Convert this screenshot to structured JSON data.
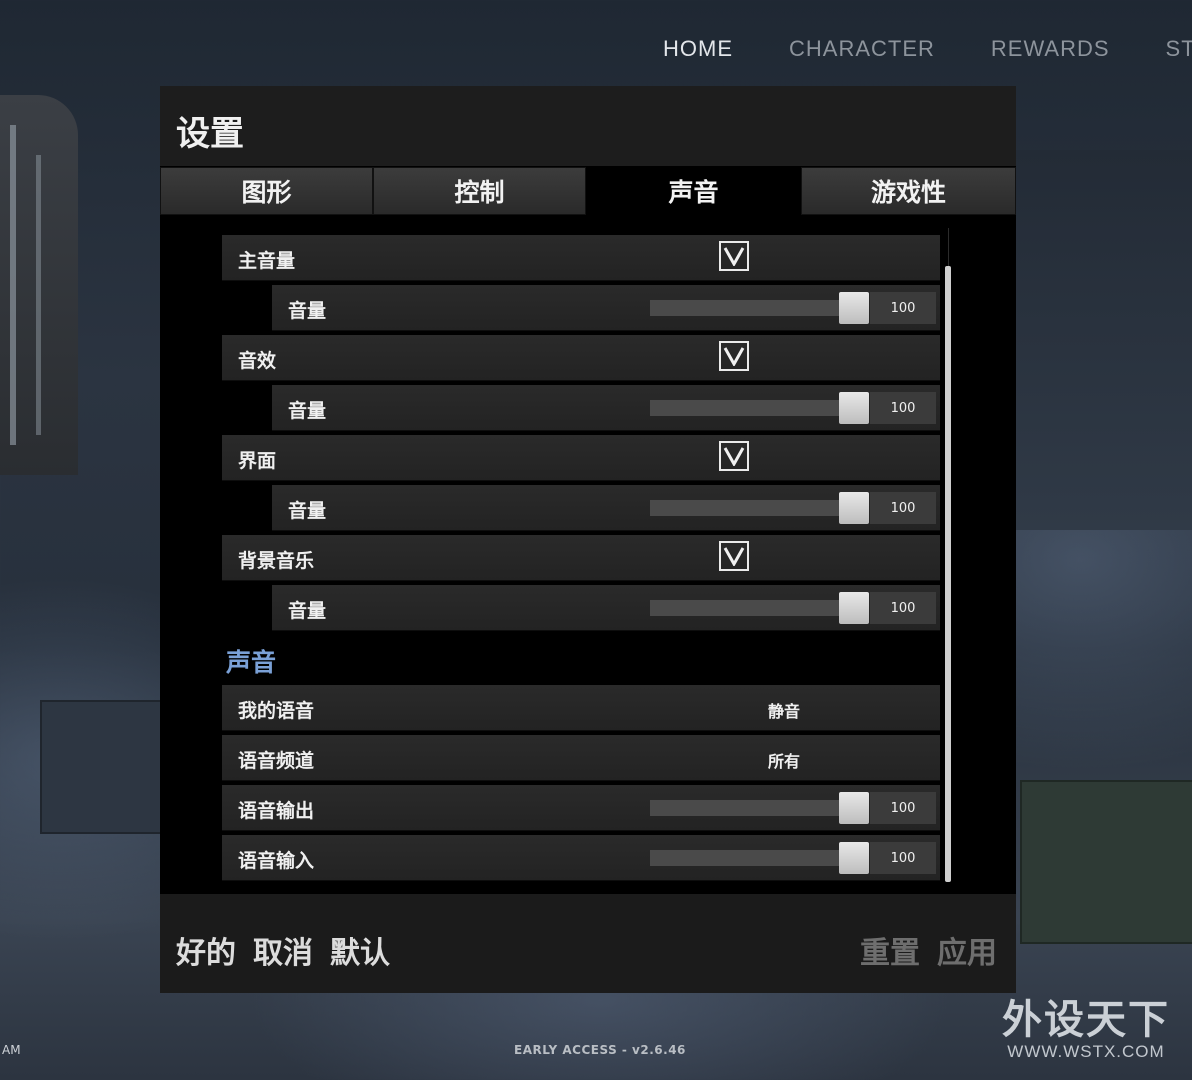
{
  "top_nav": {
    "items": [
      {
        "label": "HOME",
        "active": true
      },
      {
        "label": "CHARACTER",
        "active": false
      },
      {
        "label": "REWARDS",
        "active": false
      },
      {
        "label": "STAT",
        "active": false
      }
    ]
  },
  "settings": {
    "title": "设置",
    "tabs": [
      {
        "label": "图形",
        "active": false
      },
      {
        "label": "控制",
        "active": false
      },
      {
        "label": "声音",
        "active": true
      },
      {
        "label": "游戏性",
        "active": false
      }
    ],
    "audio_groups": [
      {
        "label": "主音量",
        "enabled": true,
        "volume_label": "音量",
        "volume": "100"
      },
      {
        "label": "音效",
        "enabled": true,
        "volume_label": "音量",
        "volume": "100"
      },
      {
        "label": "界面",
        "enabled": true,
        "volume_label": "音量",
        "volume": "100"
      },
      {
        "label": "背景音乐",
        "enabled": true,
        "volume_label": "音量",
        "volume": "100"
      }
    ],
    "voice_section": {
      "title": "声音",
      "my_voice": {
        "label": "我的语音",
        "value": "静音"
      },
      "voice_channel": {
        "label": "语音频道",
        "value": "所有"
      },
      "voice_output": {
        "label": "语音输出",
        "value": "100"
      },
      "voice_input": {
        "label": "语音输入",
        "value": "100"
      }
    },
    "footer": {
      "ok": "好的",
      "cancel": "取消",
      "default": "默认",
      "reset": "重置",
      "apply": "应用"
    }
  },
  "version": "EARLY ACCESS - v2.6.46",
  "clock_fragment": "AM",
  "watermark": {
    "name": "外设天下",
    "url": "WWW.WSTX.COM"
  },
  "colors": {
    "accent": "#7aa0d6",
    "panel": "#1d1d1d",
    "content_bg": "#000000"
  }
}
